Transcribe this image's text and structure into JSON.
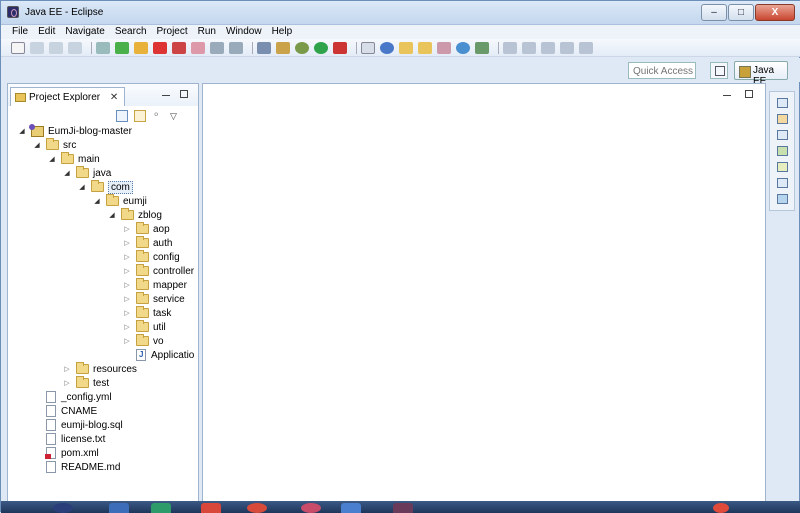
{
  "window": {
    "title": "Java EE - Eclipse",
    "controls": [
      "–",
      "□",
      "X"
    ]
  },
  "menu": [
    "File",
    "Edit",
    "Navigate",
    "Search",
    "Project",
    "Run",
    "Window",
    "Help"
  ],
  "quick_access": {
    "placeholder": "Quick Access"
  },
  "perspective": {
    "active": "Java EE"
  },
  "explorer": {
    "tab_label": "Project Explorer",
    "tab_close": "✕",
    "tree": [
      {
        "label": "EumJi-blog-master",
        "icon": "project-icon",
        "expanded": true
      },
      {
        "label": "src",
        "icon": "folder-icon",
        "expanded": true
      },
      {
        "label": "main",
        "icon": "folder-icon",
        "expanded": true
      },
      {
        "label": "java",
        "icon": "folder-icon",
        "expanded": true
      },
      {
        "label": "com",
        "icon": "folder-icon",
        "expanded": true,
        "selected": true
      },
      {
        "label": "eumji",
        "icon": "folder-icon",
        "expanded": true
      },
      {
        "label": "zblog",
        "icon": "folder-icon",
        "expanded": true
      },
      {
        "label": "aop",
        "icon": "folder-icon",
        "expanded": false
      },
      {
        "label": "auth",
        "icon": "folder-icon",
        "expanded": false
      },
      {
        "label": "config",
        "icon": "folder-icon",
        "expanded": false
      },
      {
        "label": "controller",
        "icon": "folder-icon",
        "expanded": false
      },
      {
        "label": "mapper",
        "icon": "folder-icon",
        "expanded": false
      },
      {
        "label": "service",
        "icon": "folder-icon",
        "expanded": false
      },
      {
        "label": "task",
        "icon": "folder-icon",
        "expanded": false
      },
      {
        "label": "util",
        "icon": "folder-icon",
        "expanded": false
      },
      {
        "label": "vo",
        "icon": "folder-icon",
        "expanded": false
      },
      {
        "label": "Applicatio",
        "icon": "java-file-icon"
      },
      {
        "label": "resources",
        "icon": "folder-icon",
        "expanded": false
      },
      {
        "label": "test",
        "icon": "folder-icon",
        "expanded": false
      },
      {
        "label": "_config.yml",
        "icon": "file-icon"
      },
      {
        "label": "CNAME",
        "icon": "file-icon"
      },
      {
        "label": "eumji-blog.sql",
        "icon": "file-icon"
      },
      {
        "label": "license.txt",
        "icon": "file-icon"
      },
      {
        "label": "pom.xml",
        "icon": "xml-file-icon"
      },
      {
        "label": "README.md",
        "icon": "file-icon"
      }
    ]
  },
  "colors": {
    "window_bg": "#dfe9f5",
    "titlebar": "#c4d7ee",
    "folder": "#f2d98a",
    "close_button": "#c9452f"
  }
}
